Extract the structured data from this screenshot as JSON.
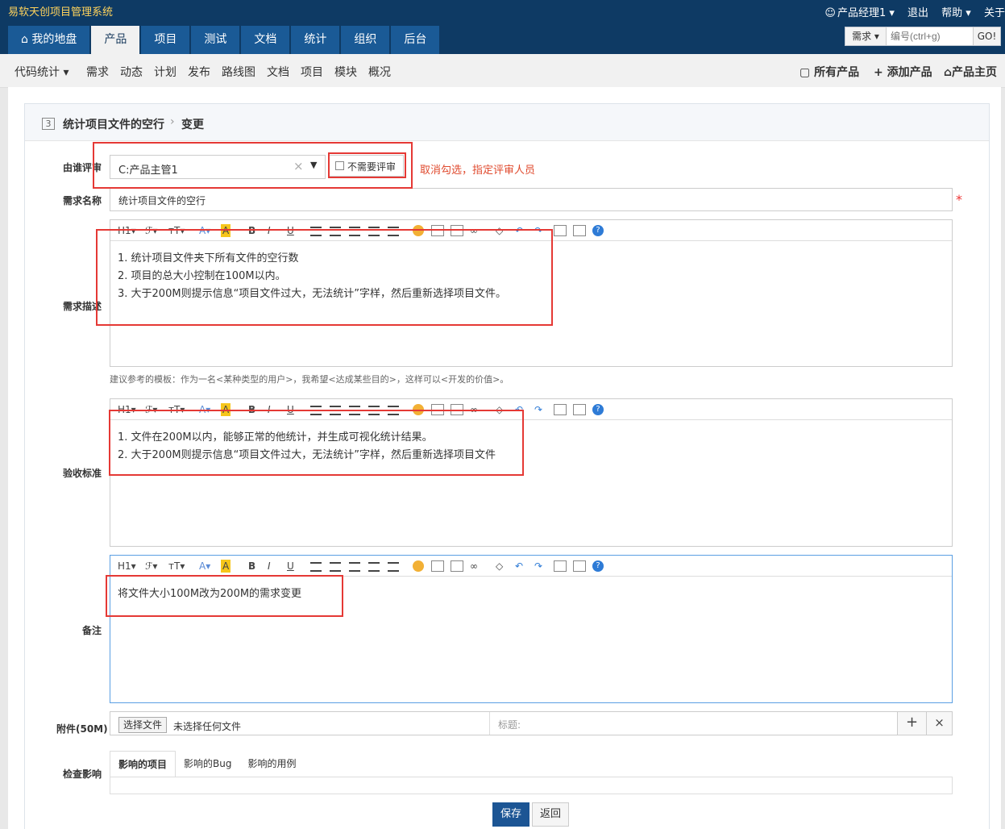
{
  "header": {
    "app_title": "易软天创项目管理系统",
    "user": "产品经理1 ▾",
    "logout": "退出",
    "help": "帮助 ▾",
    "about": "关于",
    "nav_tabs": [
      "我的地盘",
      "产品",
      "项目",
      "测试",
      "文档",
      "统计",
      "组织",
      "后台"
    ],
    "active_tab": "产品",
    "search": {
      "type": "需求 ▾",
      "placeholder": "编号(ctrl+g)",
      "go": "GO!"
    }
  },
  "subnav": {
    "items": [
      "代码统计 ▾",
      "需求",
      "动态",
      "计划",
      "发布",
      "路线图",
      "文档",
      "项目",
      "模块",
      "概况"
    ],
    "right": [
      "所有产品",
      "添加产品",
      "产品主页"
    ]
  },
  "breadcrumb": {
    "id": "3",
    "title": "统计项目文件的空行",
    "sep": "›",
    "action": "变更"
  },
  "form": {
    "reviewer_label": "由谁评审",
    "reviewer_value": "C:产品主管1",
    "reviewer_clear": "×",
    "no_review_label": "不需要评审",
    "annotation": "取消勾选，指定评审人员",
    "name_label": "需求名称",
    "name_value": "统计项目文件的空行",
    "required": "*",
    "desc_label": "需求描述",
    "desc_lines": [
      "1. 统计项目文件夹下所有文件的空行数",
      "2. 项目的总大小控制在100M以内。",
      "3. 大于200M则提示信息“项目文件过大，无法统计”字样，然后重新选择项目文件。"
    ],
    "hint": "建议参考的模板：作为一名<某种类型的用户>，我希望<达成某些目的>，这样可以<开发的价值>。",
    "verify_label": "验收标准",
    "verify_lines": [
      "1. 文件在200M以内，能够正常的他统计，并生成可视化统计结果。",
      "2. 大于200M则提示信息“项目文件过大，无法统计”字样，然后重新选择项目文件"
    ],
    "comment_label": "备注",
    "comment_value": "将文件大小100M改为200M的需求变更",
    "attach_label": "附件(50M)",
    "choose_file": "选择文件",
    "no_file": "未选择任何文件",
    "attach_title_placeholder": "标题:",
    "add": "+",
    "remove": "×",
    "impact_label": "检查影响",
    "impact_tabs": [
      "影响的项目",
      "影响的Bug",
      "影响的用例"
    ],
    "save": "保存",
    "back": "返回"
  },
  "colors": {
    "header_bg": "#0e3a64",
    "tab_bg": "#1a5a96",
    "app_title": "#ffd35c",
    "annotation_red": "#e53935",
    "save_bg": "#1c5594"
  }
}
